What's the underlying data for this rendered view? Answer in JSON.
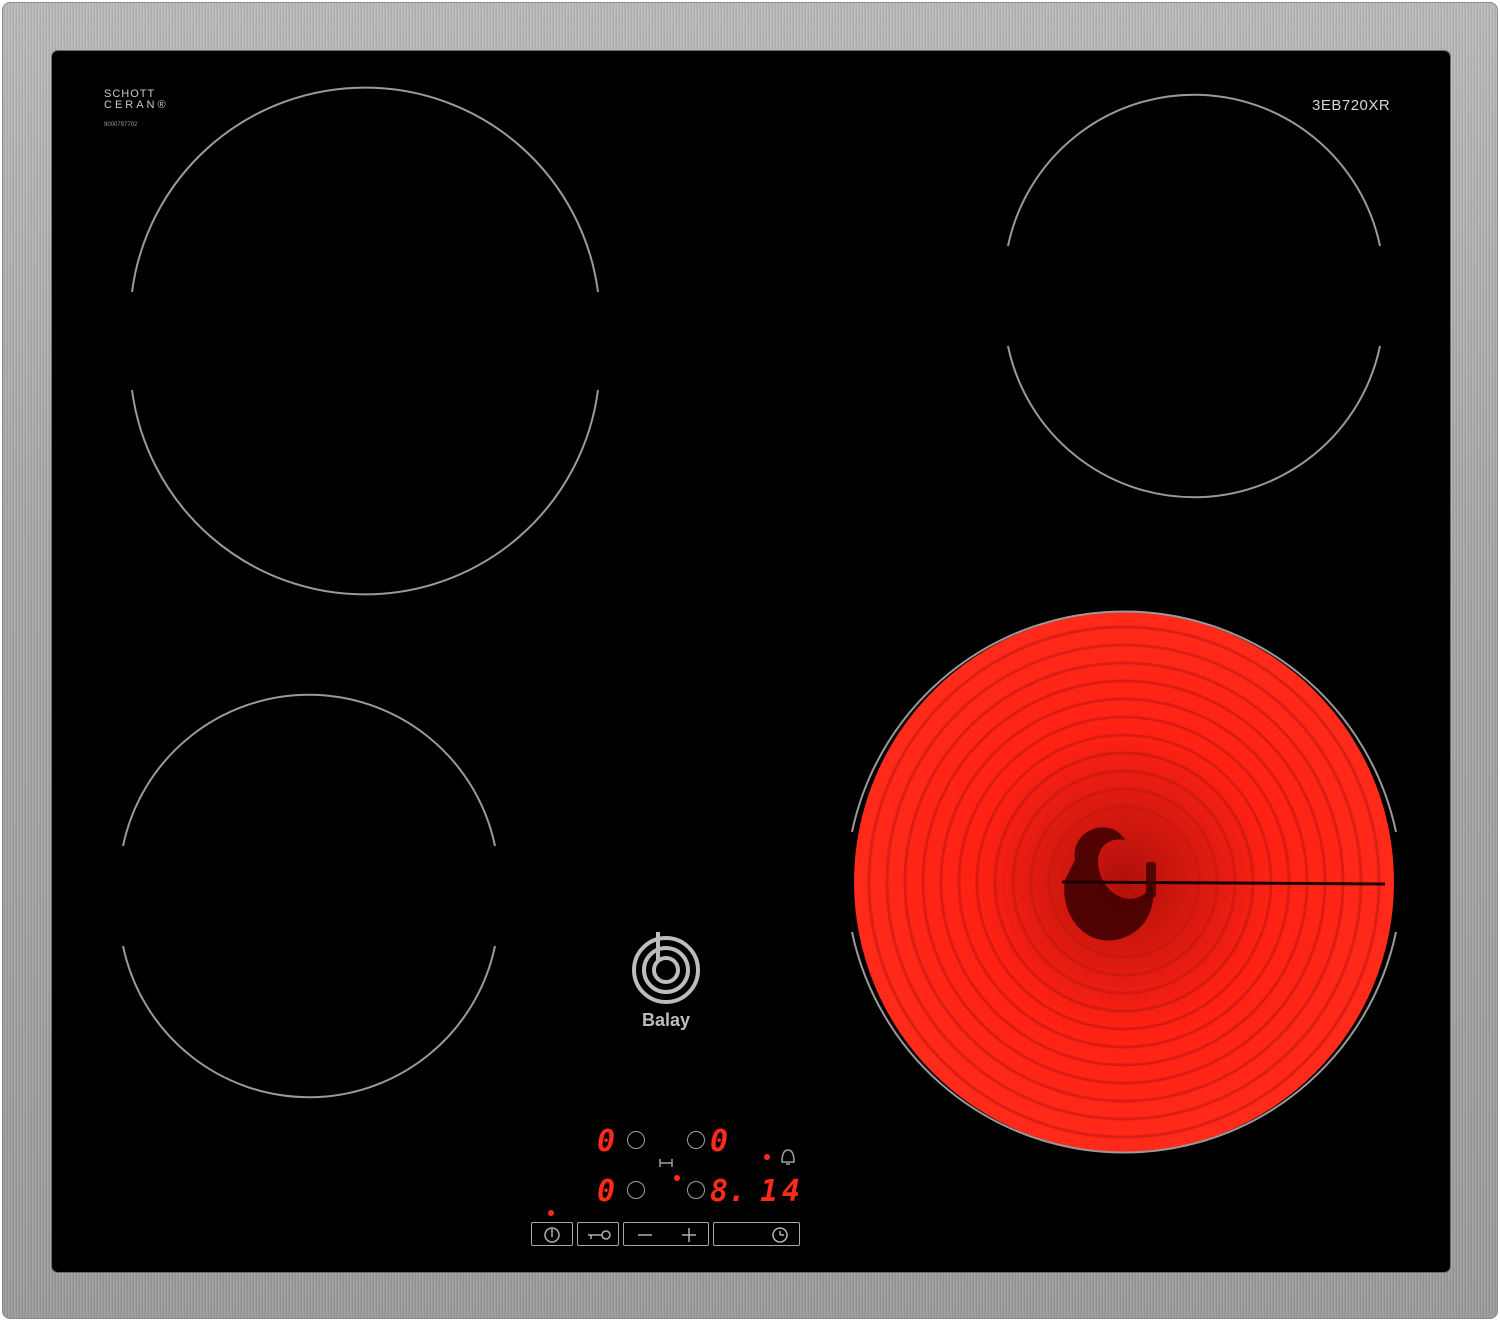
{
  "glass": {
    "certification": {
      "line1": "SCHOTT",
      "line2": "CERAN®",
      "serial": "9000797702"
    },
    "model": "3EB720XR",
    "brand": "Balay"
  },
  "zones": [
    {
      "name": "rear-left",
      "state": "off"
    },
    {
      "name": "rear-right",
      "state": "off"
    },
    {
      "name": "front-left",
      "state": "off"
    },
    {
      "name": "front-right",
      "state": "on",
      "glow_color": "#ff2214"
    }
  ],
  "display": {
    "rear_left_level": "0",
    "rear_right_level": "0",
    "front_left_level": "0",
    "front_right_level": "8.",
    "timer": "14"
  },
  "controls": {
    "power": "power-icon",
    "lock": "key-icon",
    "minus": "minus-icon",
    "plus": "plus-icon",
    "timer": "clock-icon"
  },
  "colors": {
    "glass": "#000000",
    "led": "#ff2a1a",
    "frame": "#a8a8a8"
  }
}
